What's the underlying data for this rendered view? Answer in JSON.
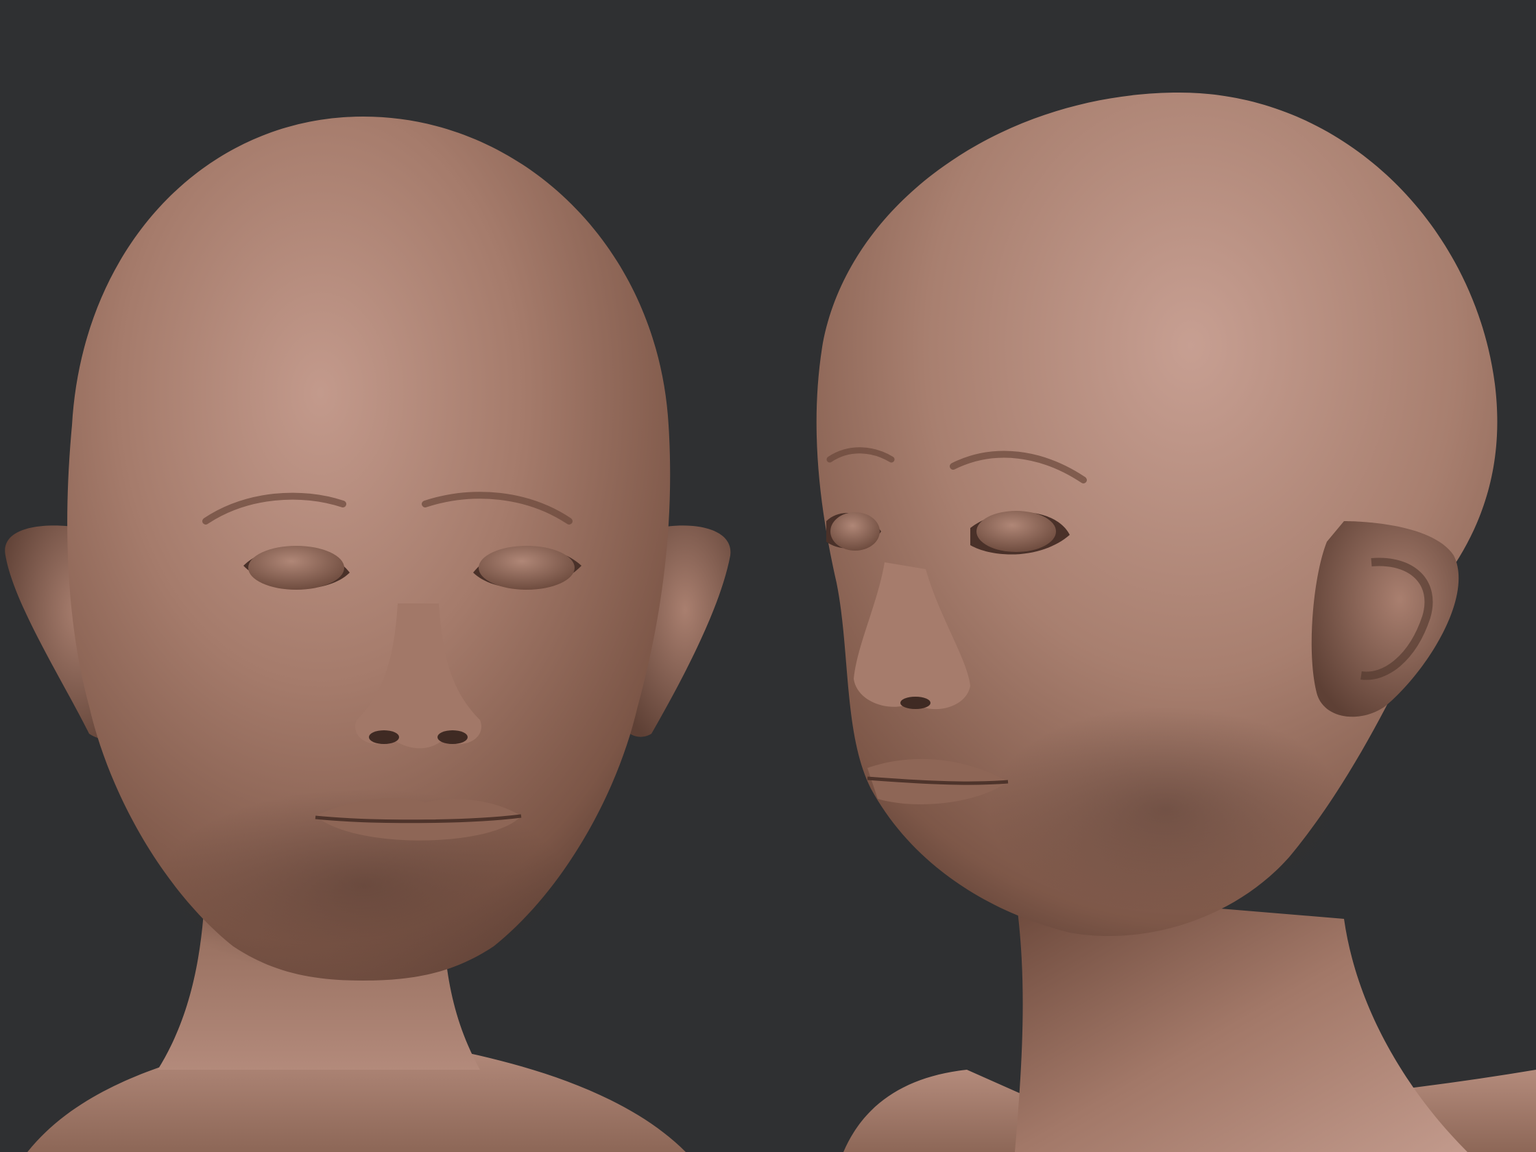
{
  "scene": {
    "background_color": "#2f3032",
    "clay_color": "#9a7262",
    "clay_highlight": "#c0968a",
    "clay_shadow": "#553a31",
    "views": [
      {
        "view": "front"
      },
      {
        "view": "three-quarter"
      }
    ]
  }
}
